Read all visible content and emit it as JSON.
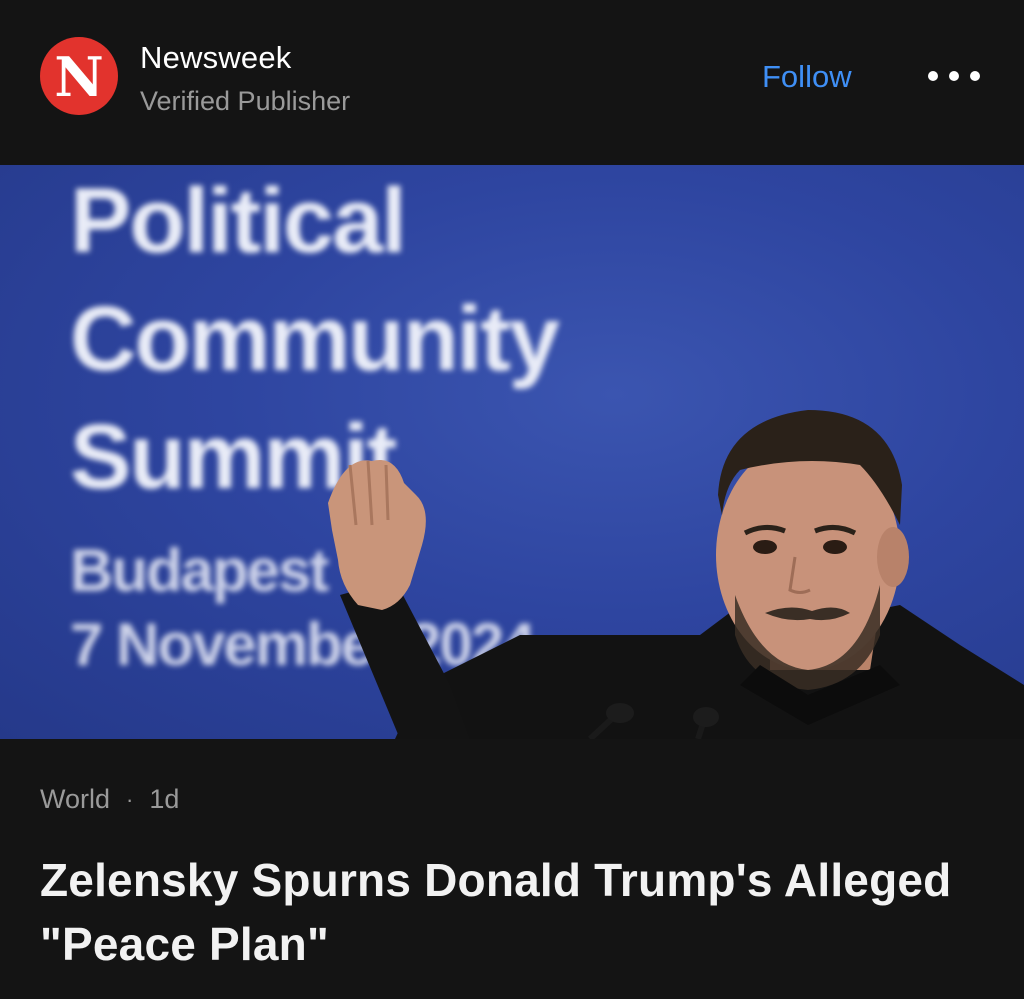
{
  "publisher": {
    "logo_letter": "N",
    "name": "Newsweek",
    "subtitle": "Verified Publisher",
    "follow_label": "Follow",
    "more_icon": "more-horizontal-icon",
    "brand_color": "#e2332d",
    "accent_color": "#3f8ff5"
  },
  "hero": {
    "backdrop_lines": [
      "Political",
      "Community",
      "Summit",
      "Budapest",
      "7 November 2024"
    ]
  },
  "article": {
    "category": "World",
    "separator": "·",
    "age": "1d",
    "headline": "Zelensky Spurns Donald Trump's Alleged \"Peace Plan\""
  }
}
